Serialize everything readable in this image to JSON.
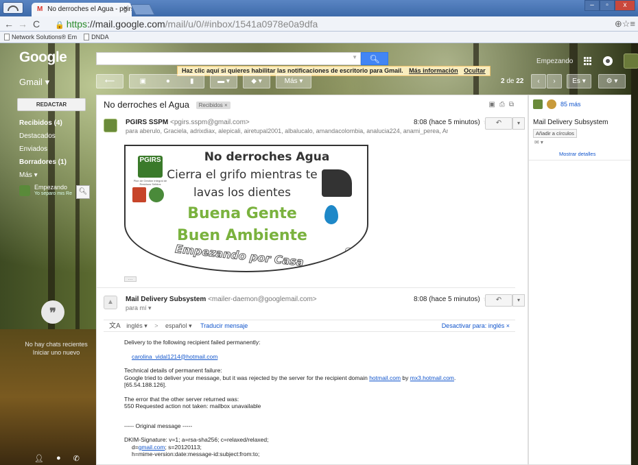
{
  "browser": {
    "tab_title": "No derroches el Agua - pgirs",
    "tab_close": "×",
    "url_https": "https",
    "url_rest": "://mail.google.com",
    "url_path": "/mail/u/0/#inbox/1541a0978e0a9dfa",
    "bookmarks": [
      "Network Solutions® Em",
      "DNDA"
    ]
  },
  "gmail": {
    "logo": "Google",
    "product": "Gmail",
    "user_name": "Empezando",
    "notice": "Haz clic aquí si quieres habilitar las notificaciones de escritorio para Gmail.",
    "notice_more": "Más información",
    "notice_hide": "Ocultar",
    "toolbar_more": "Más",
    "page_count_range": "2",
    "page_count_sep": "de",
    "page_count_total": "22",
    "lang_btn": "Es",
    "compose": "REDACTAR",
    "nav": [
      {
        "label": "Recibidos (4)",
        "bold": true
      },
      {
        "label": "Destacados",
        "bold": false
      },
      {
        "label": "Enviados",
        "bold": false
      },
      {
        "label": "Borradores (1)",
        "bold": true
      },
      {
        "label": "Más",
        "bold": false
      }
    ],
    "chat_user": "Empezando",
    "chat_status": "Yo separo mis Re",
    "no_chats": "No hay chats recientes",
    "start_new": "Iniciar uno nuevo"
  },
  "thread": {
    "subject": "No derroches el Agua",
    "label_chip": "Recibidos",
    "msg1": {
      "sender_name": "PGIRS SSPM",
      "sender_email": "<pgirs.sspm@gmail.com>",
      "time": "8:08 (hace 5 minutos)",
      "recipients": "para aberulo, Graciela, adrixdiax, alepicali, airetupal2001, albalucalo, amandacolombia, analucia224, anami_perea, An"
    },
    "poster": {
      "line1": "No derroches Agua",
      "line2": "Cierra el grifo mientras te",
      "line3": "lavas los dientes",
      "line4": "Buena Gente",
      "line5": "Buen Ambiente",
      "line6": "Empezando por Casa",
      "logo": "PGIRS",
      "logo_sub": "Plan de Gestión Integral de Residuos Sólidos"
    },
    "msg2": {
      "sender_name": "Mail Delivery Subsystem",
      "sender_email": "<mailer-daemon@googlemail.com>",
      "time": "8:08 (hace 5 minutos)",
      "recipients": "para mí"
    },
    "translate": {
      "from": "inglés",
      "arrow": ">",
      "to": "español",
      "action": "Traducir mensaje",
      "disable": "Desactivar para: inglés ×"
    },
    "body": {
      "p1": "Delivery to the following recipient failed permanently:",
      "recipient": "carolina_vidal1214@hotmail.com",
      "p3a": "Technical details of permanent failure:",
      "p3b": "Google tried to deliver your message, but it was rejected by the server for the recipient domain",
      "p3_domain": "hotmail.com",
      "p3_by": "by",
      "p3_mx": "mx3.hotmail.com",
      "p3_ip": "[65.54.188.126].",
      "p4a": "The error that the other server returned was:",
      "p4b": "550 Requested action not taken: mailbox unavailable",
      "p5": "----- Original message -----",
      "p6a": "DKIM-Signature: v=1; a=rsa-sha256; c=relaxed/relaxed;",
      "p6b_pre": "d=",
      "p6b_link": "gmail.com",
      "p6b_post": "; s=20120113;",
      "p6c": "h=mime-version:date:message-id:subject:from:to;"
    }
  },
  "people": {
    "more": "85 más",
    "name": "Mail Delivery Subsystem",
    "add_circles": "Añadir a círculos",
    "details": "Mostrar detalles"
  },
  "colors": {
    "accent": "#4285f4",
    "link": "#1155cc",
    "notice_bg": "#f9edbe",
    "poster_green": "#7ab23e"
  }
}
